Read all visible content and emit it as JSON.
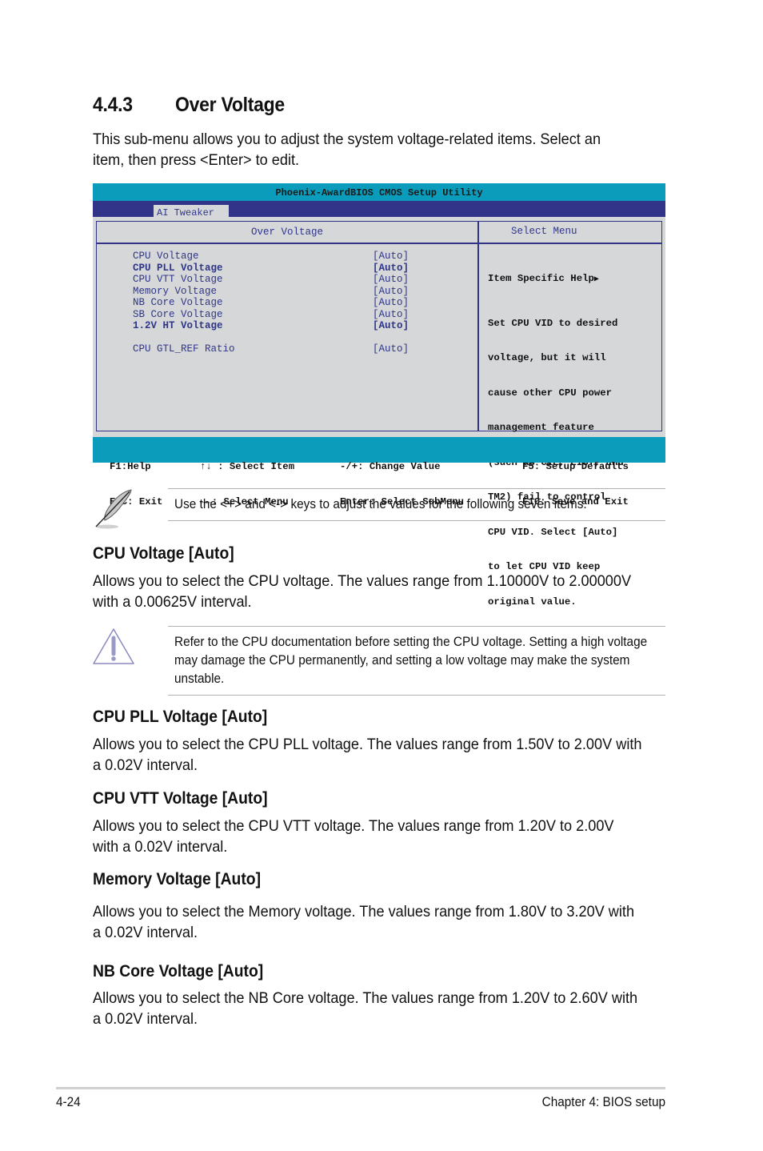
{
  "section": {
    "number": "4.4.3",
    "title": "Over Voltage",
    "intro": "This sub-menu allows you to adjust the system voltage-related items. Select an item, then press <Enter> to edit."
  },
  "bios": {
    "title": "Phoenix-AwardBIOS CMOS Setup Utility",
    "active_tab": "AI Tweaker",
    "left_header": "Over Voltage",
    "right_header": "Select Menu",
    "items": [
      {
        "label": "CPU Voltage",
        "value": "[Auto]",
        "bold": false
      },
      {
        "label": "CPU PLL Voltage",
        "value": "[Auto]",
        "bold": true
      },
      {
        "label": "CPU VTT Voltage",
        "value": "[Auto]",
        "bold": false
      },
      {
        "label": "Memory Voltage",
        "value": "[Auto]",
        "bold": false
      },
      {
        "label": "NB Core Voltage",
        "value": "[Auto]",
        "bold": false
      },
      {
        "label": "SB Core Voltage",
        "value": "[Auto]",
        "bold": false
      },
      {
        "label": "1.2V HT Voltage",
        "value": "[Auto]",
        "bold": true
      },
      {
        "label": "CPU GTL_REF Ratio",
        "value": "[Auto]",
        "bold": false
      }
    ],
    "help_heading": "Item Specific Help",
    "help_lines": [
      "Set CPU VID to desired",
      "voltage, but it will",
      "cause other CPU power",
      "management feature",
      "(such as C1E, EIST, and",
      "TM2) fail to control",
      "CPU VID. Select [Auto]",
      "to let CPU VID keep",
      "original value."
    ],
    "footer": {
      "col1": [
        "F1:Help",
        "ESC: Exit"
      ],
      "col2": [
        "↑↓ : Select Item",
        "→←: Select Menu"
      ],
      "col3": [
        "-/+: Change Value",
        "Enter: Select SubMenu"
      ],
      "col4": [
        "F5: Setup Defaults",
        "F10: Save and Exit"
      ]
    },
    "colors": {
      "title_bar": "#0a9cba",
      "menu_bar": "#32348a",
      "panel_bg": "#d6d7d9",
      "text_blue": "#2f3688"
    }
  },
  "notes": {
    "tip": "Use the <+> and <-> keys to adjust the values for the following seven items.",
    "warning": "Refer to the CPU documentation before setting the CPU voltage. Setting a high voltage may damage the CPU permanently, and setting a low voltage may make the system unstable."
  },
  "subsections": [
    {
      "heading": "CPU Voltage [Auto]",
      "body": "Allows you to select the CPU voltage. The values range from 1.10000V to 2.00000V with a 0.00625V interval."
    },
    {
      "heading": "CPU PLL Voltage [Auto]",
      "body": "Allows you to select the CPU PLL voltage. The values range from 1.50V to 2.00V with a 0.02V interval."
    },
    {
      "heading": "CPU VTT Voltage [Auto]",
      "body": "Allows you to select the CPU VTT voltage. The values range from 1.20V to 2.00V with a 0.02V interval."
    },
    {
      "heading": "Memory Voltage [Auto]",
      "body": "Allows you to select the Memory voltage. The values range from 1.80V to 3.20V with a 0.02V interval."
    },
    {
      "heading": "NB Core Voltage [Auto]",
      "body": "Allows you to select the NB Core voltage. The values range from 1.20V to 2.60V with a 0.02V interval."
    }
  ],
  "page_footer": {
    "page_number": "4-24",
    "chapter": "Chapter 4: BIOS setup"
  }
}
